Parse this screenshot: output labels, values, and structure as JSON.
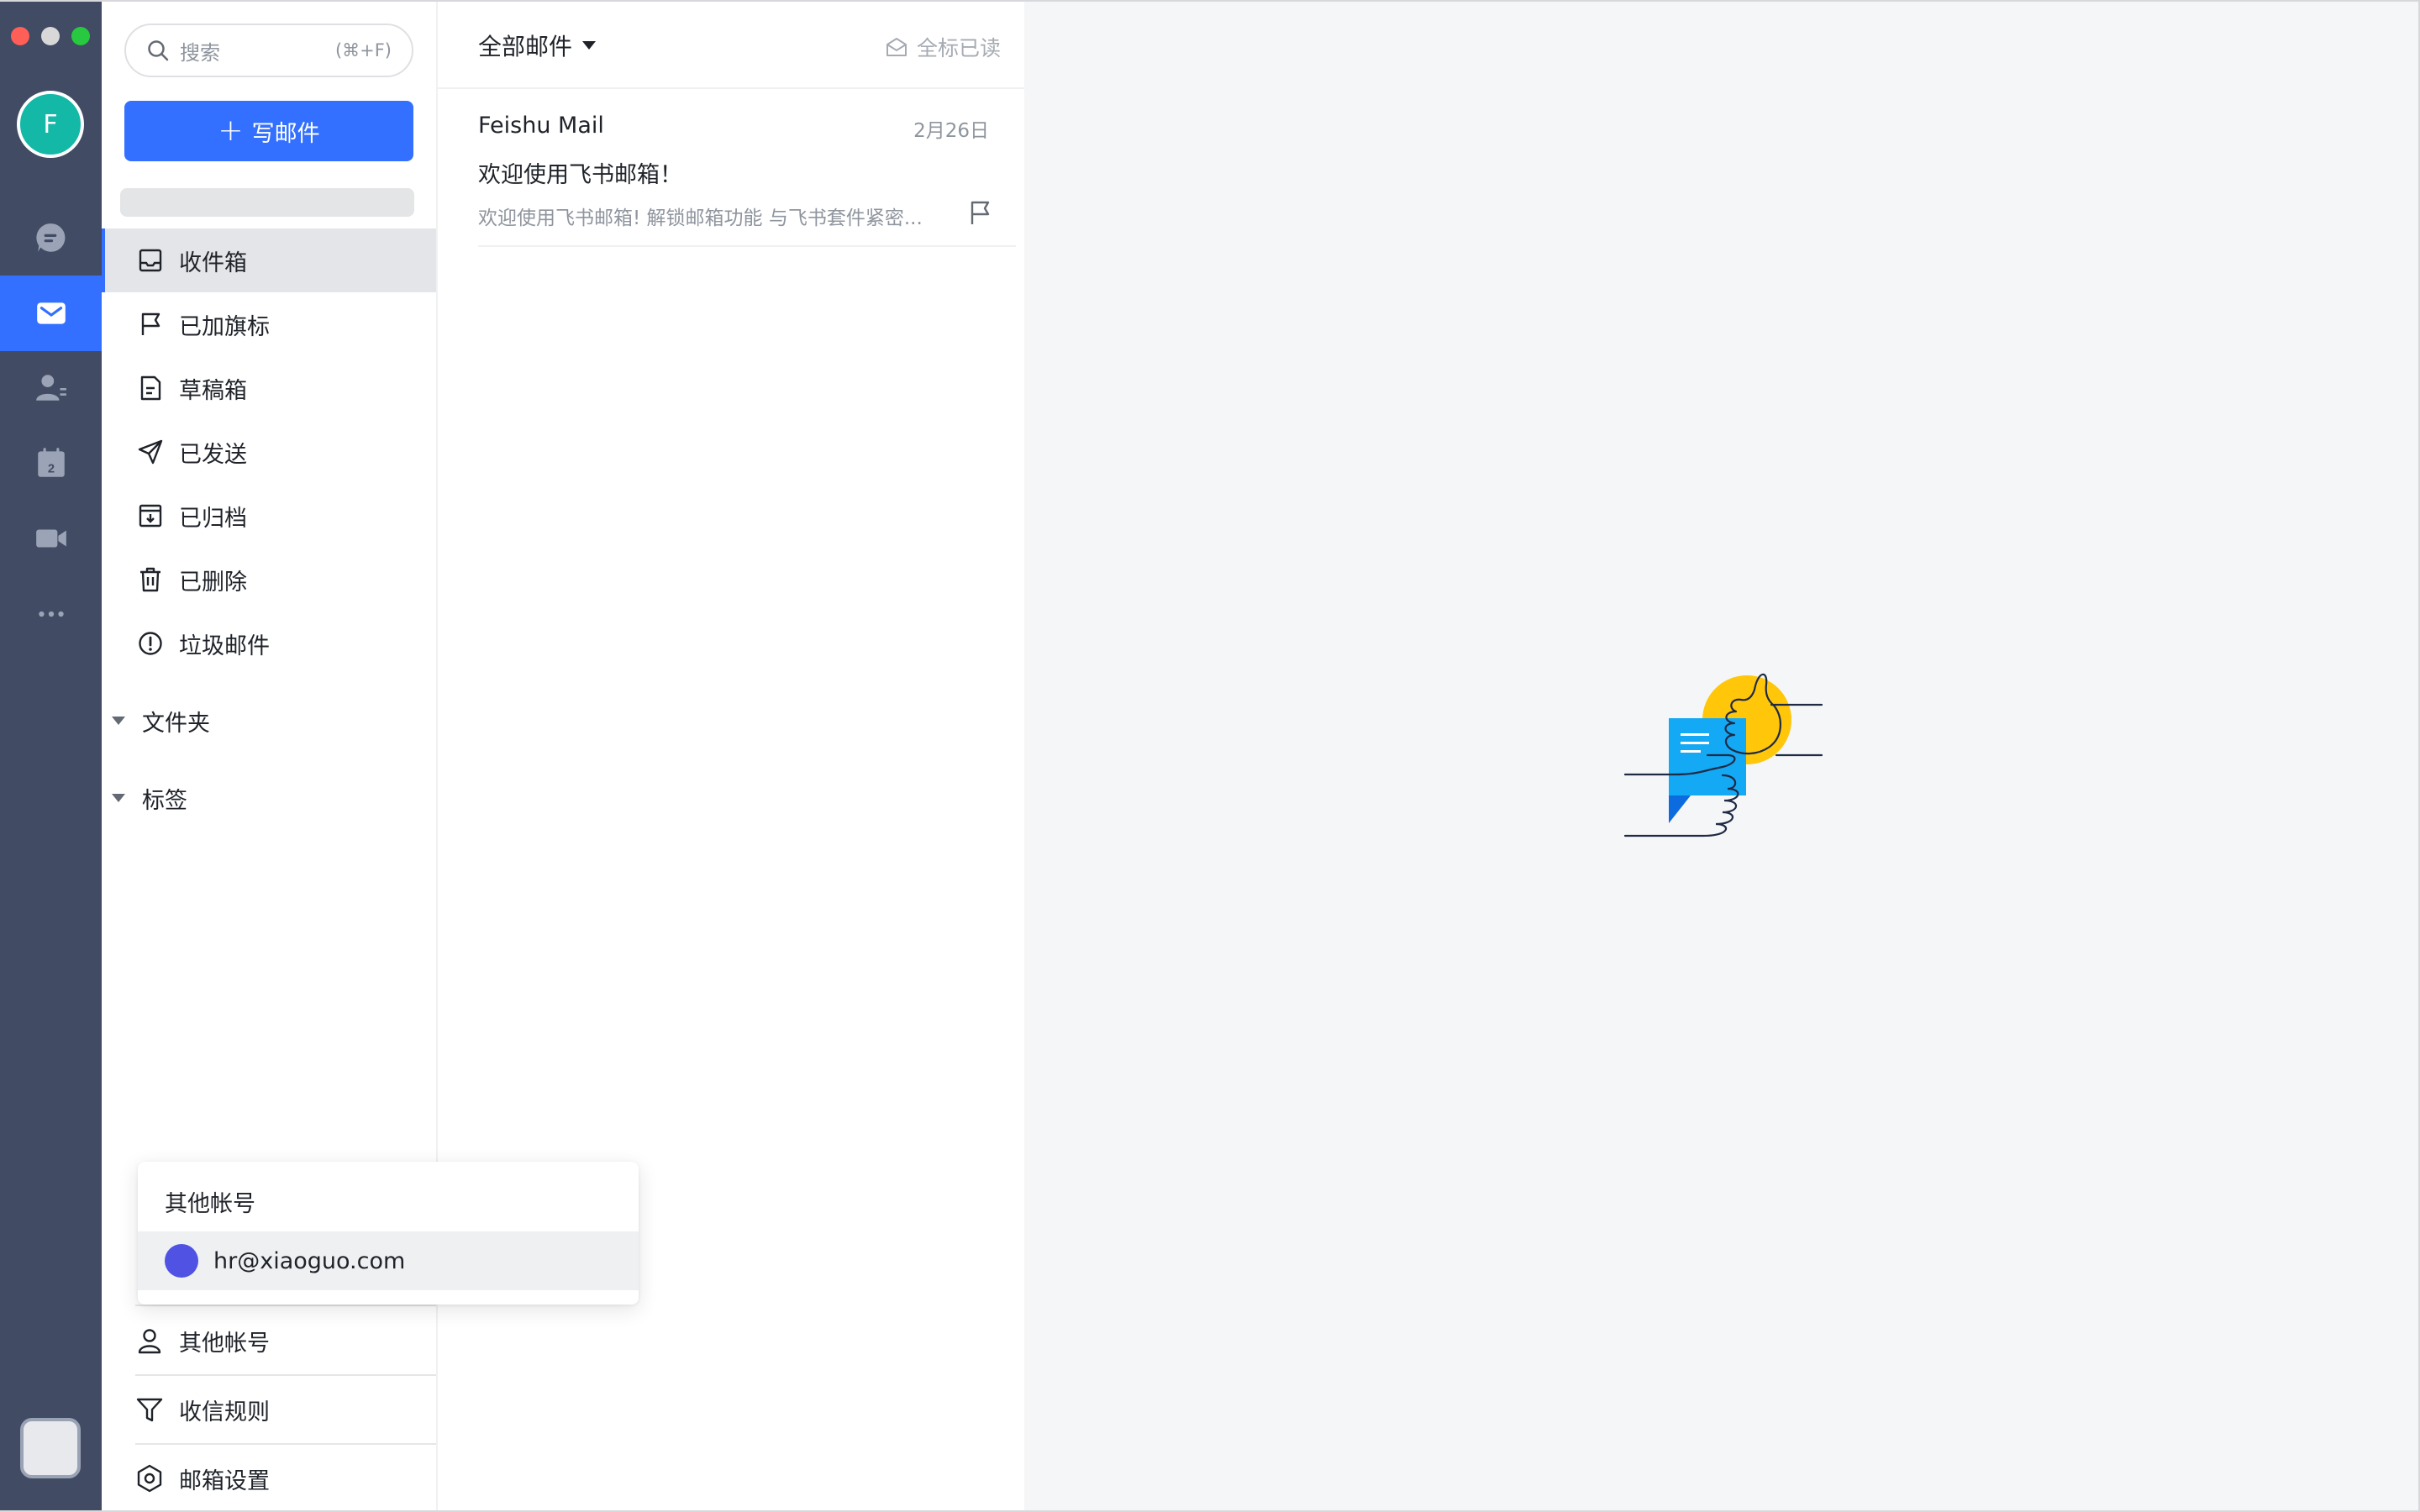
{
  "rail": {
    "avatar_letter": "F",
    "items": [
      "chat-icon",
      "mail-icon",
      "contacts-icon",
      "calendar-icon",
      "video-icon",
      "more-icon"
    ],
    "calendar_day": "2",
    "accent": "#3370ff",
    "background": "#414b63"
  },
  "sidebar": {
    "search_placeholder": "搜索",
    "search_shortcut": "(⌘+F)",
    "compose_label": "写邮件",
    "folders": [
      {
        "label": "收件箱",
        "icon": "inbox-icon"
      },
      {
        "label": "已加旗标",
        "icon": "flag-icon"
      },
      {
        "label": "草稿箱",
        "icon": "draft-icon"
      },
      {
        "label": "已发送",
        "icon": "send-icon"
      },
      {
        "label": "已归档",
        "icon": "archive-icon"
      },
      {
        "label": "已删除",
        "icon": "trash-icon"
      },
      {
        "label": "垃圾邮件",
        "icon": "spam-icon"
      }
    ],
    "sections": [
      {
        "label": "文件夹"
      },
      {
        "label": "标签"
      }
    ],
    "bottom": [
      {
        "label": "其他帐号",
        "icon": "person-icon"
      },
      {
        "label": "收信规则",
        "icon": "filter-icon"
      },
      {
        "label": "邮箱设置",
        "icon": "settings-icon"
      }
    ]
  },
  "list": {
    "title": "全部邮件",
    "mark_all_read": "全标已读",
    "items": [
      {
        "sender": "Feishu Mail",
        "date": "2月26日",
        "subject": "欢迎使用飞书邮箱！",
        "preview": "欢迎使用飞书邮箱! 解锁邮箱功能 与飞书套件紧密..."
      }
    ]
  },
  "popover": {
    "title": "其他帐号",
    "account_email": "hr@xiaoguo.com",
    "account_color": "#4f52e3"
  }
}
